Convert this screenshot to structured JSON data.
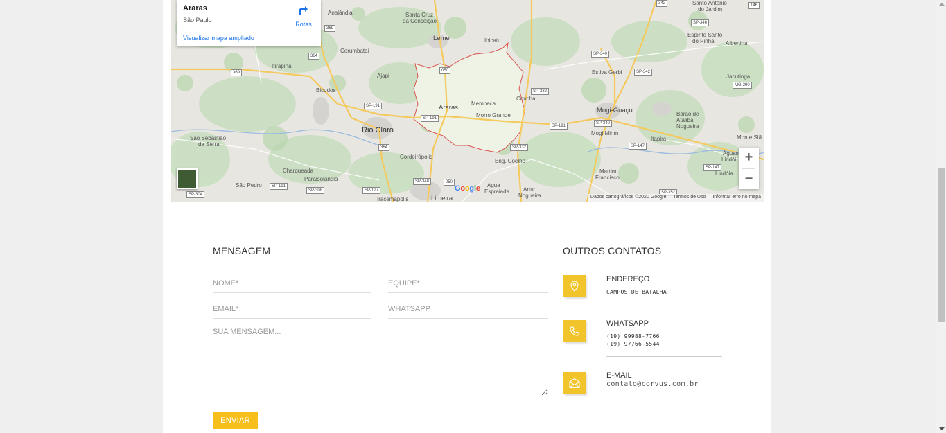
{
  "map": {
    "place_name": "Araras",
    "place_region": "São Paulo",
    "enlarge_link": "Visualizar mapa ampliado",
    "directions_label": "Rotas",
    "zoom_in": "+",
    "zoom_out": "−",
    "google_logo": "Google",
    "attribution": {
      "data": "Dados cartográficos ©2020 Google",
      "terms": "Termos de Uso",
      "report": "Informar erro no mapa"
    },
    "labels": {
      "analandia": "Analândia",
      "santa_cruz": "Santa Cruz",
      "da_conceicao": "da Conceição",
      "leme": "Leme",
      "ibicatu": "Ibicatu",
      "santo_antonio": "Santo Antônio",
      "do_jardim": "do Jardim",
      "espirito_santo": "Espírito Santo",
      "do_pinhal": "do Pinhal",
      "albertina": "Albertina",
      "corumbatai": "Corumbataí",
      "itirapina": "Itirapina",
      "ajapi": "Ajapi",
      "estiva_gerbi": "Estiva Gerbi",
      "jacutinga": "Jacutinga",
      "bicudos": "Bicudos",
      "conchal": "Conchal",
      "araras": "Araras",
      "membeca": "Membeca",
      "morro_grande": "Morro Grande",
      "mogi_guacu": "Mogi-Guaçu",
      "barao": "Barão de",
      "ataliba": "Ataliba",
      "nogueira": "Nogueira",
      "rio_claro": "Rio Claro",
      "mogi_mirim": "Mogi Mirim",
      "sao_sebastiao": "São Sebastião",
      "da_serra": "da Serra",
      "itapira": "Itapira",
      "monte_sia": "Monte Siã",
      "cordeiropolis": "Cordeirópolis",
      "eng_coelho": "Eng. Coelho",
      "aguas_de": "Águas de",
      "lindoia": "Lindói",
      "lindoia2": "Lindóia",
      "charqueada": "Charqueada",
      "paraisolandia": "Paraisolândia",
      "martim": "Martim",
      "francisco": "Francisco",
      "sao_pedro": "São Pedro",
      "agua": "Agua",
      "espraiada": "Espraiada",
      "artur": "Artur",
      "nogueira2": "Nogueira",
      "iracemapolis": "Iracemápolis",
      "limeira": "Limeira"
    },
    "shields": {
      "s369a": "369",
      "s364a": "364",
      "s369b": "369",
      "s050a": "050",
      "sp191a": "SP-191",
      "sp191b": "SP-191",
      "sp191c": "SP-191",
      "sp191d": "SP-191",
      "sp332a": "SP-332",
      "sp332b": "SP-332",
      "sp340a": "SP-340",
      "sp340b": "SP-340",
      "sp342": "SP-342",
      "sp346": "SP-346",
      "mg290": "MG-290",
      "s146": "146",
      "s364b": "364",
      "sp348": "SP-348",
      "s050b": "050",
      "sp147a": "SP-147",
      "sp147b": "SP-147",
      "sp308": "SP-308",
      "sp127": "SP-127",
      "sp304": "SP-304",
      "sp352": "SP-352",
      "s342t": "342"
    }
  },
  "form": {
    "title": "MENSAGEM",
    "name_placeholder": "NOME*",
    "team_placeholder": "EQUIPE*",
    "email_placeholder": "EMAIL*",
    "whatsapp_placeholder": "WHATSAPP",
    "message_placeholder": "SUA MENSAGEM...",
    "send_label": "ENVIAR"
  },
  "contacts": {
    "title": "OUTROS CONTATOS",
    "address": {
      "label": "ENDEREÇO",
      "value": "CAMPOS DE BATALHA"
    },
    "whatsapp": {
      "label": "WHATSAPP",
      "phone1": "(19) 99988-7766",
      "phone2": "(19) 97766-5544"
    },
    "email": {
      "label": "E-MAIL",
      "value": "contato@corvus.com.br"
    }
  },
  "colors": {
    "accent": "#f6bf1b",
    "icon_bg": "#f0c42a",
    "link": "#1a73e8",
    "boundary": "#d9534f"
  }
}
